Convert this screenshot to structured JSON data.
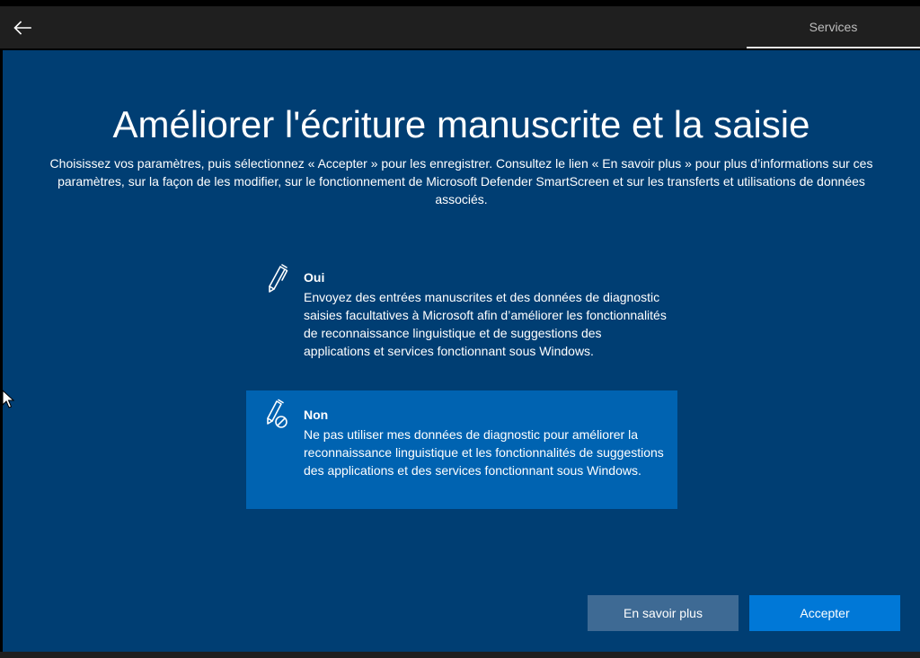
{
  "header": {
    "back_icon": "arrow-left-icon",
    "tab_label": "Services"
  },
  "main": {
    "title": "Améliorer l'écriture manuscrite et la saisie",
    "subtitle": "Choisissez vos paramètres, puis sélectionnez « Accepter » pour les enregistrer. Consultez le lien « En savoir plus » pour plus d’informations sur ces paramètres, sur la façon de les modifier, sur le fonctionnement de Microsoft Defender SmartScreen et sur les transferts et utilisations de données associés."
  },
  "options": {
    "yes": {
      "icon": "pen-icon",
      "title": "Oui",
      "description": "Envoyez des entrées manuscrites et des données de diagnostic saisies facultatives à Microsoft afin d’améliorer les fonctionnalités de reconnaissance linguistique et de suggestions des applications et services fonctionnant sous Windows."
    },
    "no": {
      "icon": "pen-disabled-icon",
      "title": "Non",
      "description": "Ne pas utiliser mes données de diagnostic pour améliorer la reconnaissance linguistique et les fonctionnalités de suggestions des applications et des services fonctionnant sous Windows.",
      "selected": true
    }
  },
  "footer": {
    "learn_more_label": "En savoir plus",
    "accept_label": "Accepter"
  },
  "colors": {
    "background": "#003e73",
    "selected_option": "#0063b1",
    "accept_button": "#0078d7",
    "learn_more_button": "#3e6a94",
    "topbar": "#1f1f1f"
  }
}
